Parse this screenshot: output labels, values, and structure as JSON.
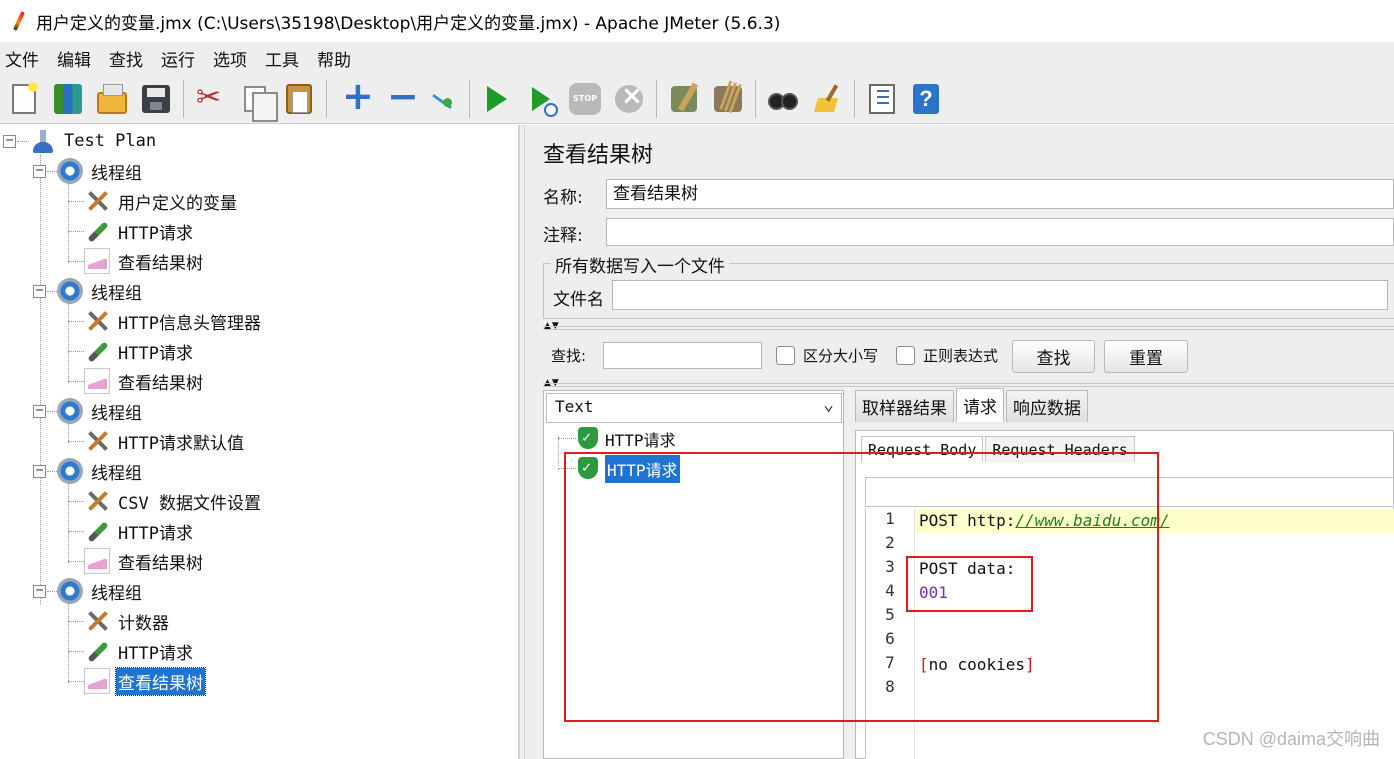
{
  "window": {
    "title": "用户定义的变量.jmx (C:\\Users\\35198\\Desktop\\用户定义的变量.jmx) - Apache JMeter (5.6.3)"
  },
  "menu": [
    "文件",
    "编辑",
    "查找",
    "运行",
    "选项",
    "工具",
    "帮助"
  ],
  "toolbar": {
    "icons": [
      "new-icon",
      "templates-icon",
      "open-icon",
      "save-icon",
      "cut-icon",
      "copy-icon",
      "paste-icon",
      "expand-icon",
      "collapse-icon",
      "toggle-icon",
      "start-icon",
      "start-no-timers-icon",
      "stop-icon",
      "shutdown-icon",
      "clear-icon",
      "clear-all-icon",
      "search-icon",
      "reset-search-icon",
      "function-helper-icon",
      "help-icon"
    ],
    "stop_label": "STOP"
  },
  "tree": {
    "root": "Test Plan",
    "groups": [
      {
        "label": "线程组",
        "children": [
          "用户定义的变量",
          "HTTP请求",
          "查看结果树"
        ]
      },
      {
        "label": "线程组",
        "children": [
          "HTTP信息头管理器",
          "HTTP请求",
          "查看结果树"
        ]
      },
      {
        "label": "线程组",
        "children": [
          "HTTP请求默认值"
        ]
      },
      {
        "label": "线程组",
        "children": [
          "CSV 数据文件设置",
          "HTTP请求",
          "查看结果树"
        ]
      },
      {
        "label": "线程组",
        "children": [
          "计数器",
          "HTTP请求",
          "查看结果树"
        ]
      }
    ],
    "selected": "查看结果树"
  },
  "panel": {
    "title": "查看结果树",
    "name_label": "名称:",
    "name_value": "查看结果树",
    "comment_label": "注释:",
    "comment_value": "",
    "file_group_legend": "所有数据写入一个文件",
    "file_label": "文件名",
    "file_value": "",
    "search_label": "查找:",
    "search_value": "",
    "case_sensitive_label": "区分大小写",
    "regex_label": "正则表达式",
    "find_button": "查找",
    "reset_button": "重置"
  },
  "results": {
    "renderer": "Text",
    "items": [
      "HTTP请求",
      "HTTP请求"
    ],
    "selected_index": 1,
    "tabs": [
      "取样器结果",
      "请求",
      "响应数据"
    ],
    "active_tab": "请求",
    "subtabs": [
      "Request Body",
      "Request Headers"
    ],
    "active_subtab": "Request Body"
  },
  "editor": {
    "line_numbers": [
      "1",
      "2",
      "3",
      "4",
      "5",
      "6",
      "7",
      "8"
    ],
    "line1_prefix": "POST ",
    "line1_url_prefix": "http:",
    "line1_url": "//www.baidu.com/",
    "line3": "POST data:",
    "line4": "001",
    "line7_open": "[",
    "line7_text": "no cookies",
    "line7_close": "]"
  },
  "watermark": "CSDN @daima交响曲",
  "colors": {
    "selection": "#1f73d1",
    "annotation_box": "#e21b1b",
    "highlight_line": "#ffffcc"
  }
}
